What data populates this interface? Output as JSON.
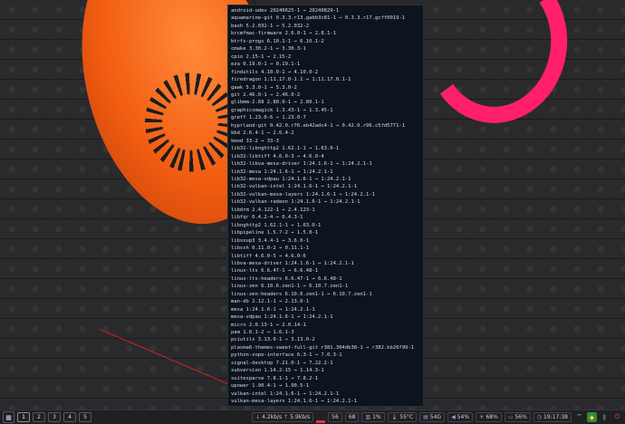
{
  "terminal": {
    "lines": [
      "android-udev 20240625-1 → 20240829-1",
      "aquamarine-git 0.3.3.r13.gabb3c81-1 → 0.3.3.r17.gcff0019-1",
      "bash 5.2.032-1 → 5.2.032-2",
      "brcmfmac-firmware 2.6.0-1 → 2.8.1-1",
      "btrfs-progs 6.10.1-1 → 6.10.1-2",
      "cmake 3.30.2-1 → 3.30.3-1",
      "cpio 2.15-1 → 2.15-2",
      "eza 0.19.0-1 → 0.19.1-1",
      "findutils 4.10.0-1 → 4.10.0-2",
      "firedragon 1:11.17.0-1.1 → 1:11.17.0.1-1",
      "gawk 5.3.0-1 → 5.3.0-2",
      "git 2.46.0-1 → 2.46.0-2",
      "glibmm-2.68 2.80.0-1 → 2.80.1-1",
      "graphicsmagick 1.3.43-1 → 1.3.45-1",
      "greff 1.23.0-6 → 1.23.0-7",
      "hyprland-git 0.42.0.r76.eb42adc4-1 → 0.42.0.r96.c5fd5771-1",
      "kbd 2.6.4-1 → 2.6.4-2",
      "kmod 33-2 → 33-3",
      "lib32-libnghttp2 1.62.1-1 → 1.63.0-1",
      "lib32-libtiff 4.6.0-3 → 4.6.0-4",
      "lib32-libva-mesa-driver 1:24.1.6-1 → 1:24.2.1-1",
      "lib32-mesa 1:24.1.6-1 → 1:24.2.1-1",
      "lib32-mesa-vdpau 1:24.1.6-1 → 1:24.2.1-1",
      "lib32-vulkan-intel 1:24.1.6-1 → 1:24.2.1-1",
      "lib32-vulkan-mesa-layers 1:24.1.6-1 → 1:24.2.1-1",
      "lib32-vulkan-radeon 1:24.1.6-1 → 1:24.2.1-1",
      "libdrm 2.4.122-1 → 2.4.123-1",
      "libfqr 0.4.2-4 → 0.4.3-1",
      "libnghttp2 1.62.1-1 → 1.63.0-1",
      "libpipeline 1.5.7-2 → 1.5.8-1",
      "libsoup3 3.4.4-1 → 3.6.0-1",
      "libssh 0.11.0-2 → 0.11.1-1",
      "libtiff 4.6.0-5 → 4.6.0-6",
      "libva-mesa-driver 1:24.1.6-1 → 1:24.2.1-1",
      "linux-lts 6.6.47-1 → 6.6.48-1",
      "linux-lts-headers 6.6.47-1 → 6.6.48-1",
      "linux-zen 6.10.6.zen1-1 → 6.10.7.zen1-1",
      "linux-zen-headers 6.10.6.zen1-1 → 6.10.7.zen1-1",
      "man-db 2.12.1-1 → 2.13.0-1",
      "mesa 1:24.1.6-1 → 1:24.2.1-1",
      "mesa-vdpau 1:24.1.6-1 → 1:24.2.1-1",
      "micro 2.0.13-1 → 2.0.14-1",
      "pam 1.6.1-2 → 1.6.1-3",
      "pciutils 3.13.0-1 → 3.13.0-2",
      "plasma6-themes-sweet-full-git r381.304db38-1 → r382.bb26f99-1",
      "python-zope-interface 6.3-1 → 7.0.3-1",
      "signal-desktop 7.21.0-1 → 7.22.2-1",
      "subversion 1.14.2-15 → 1.14.3-1",
      "suitesparse 7.8.1-1 → 7.8.2-1",
      "upower 1.90.4-1 → 1.90.5-1",
      "vulkan-intel 1:24.1.6-1 → 1:24.2.1-1",
      "vulkan-mesa-layers 1:24.1.6-1 → 1:24.2.1-1",
      "vulkan-radeon 1:24.1.6-1 → 1:24.2.1-1",
      "vulkan-swrast 1:24.1.6-1 → 1:24.2.1-1",
      "xfsprogs 6.9.0-1 → 6.10.0-1",
      "yt-dlp-git 2024.08.06.r12.gc1ba32e-1 → 2024.08.0b.r13.gad9a811-1"
    ]
  },
  "taskbar": {
    "menu_icon": "grid-menu-icon",
    "workspaces": [
      "1",
      "2",
      "3",
      "4",
      "5"
    ],
    "net_down": "4.2kb/s",
    "net_up": "5.9kb/s",
    "updates": "56",
    "cpu_label": "68",
    "mem": "1%",
    "temp": "55°C",
    "disk": "54G",
    "volume": "54%",
    "brightness": "68%",
    "battery": "56%",
    "clock": "19:17:38",
    "accent_color": "#e2343a"
  }
}
